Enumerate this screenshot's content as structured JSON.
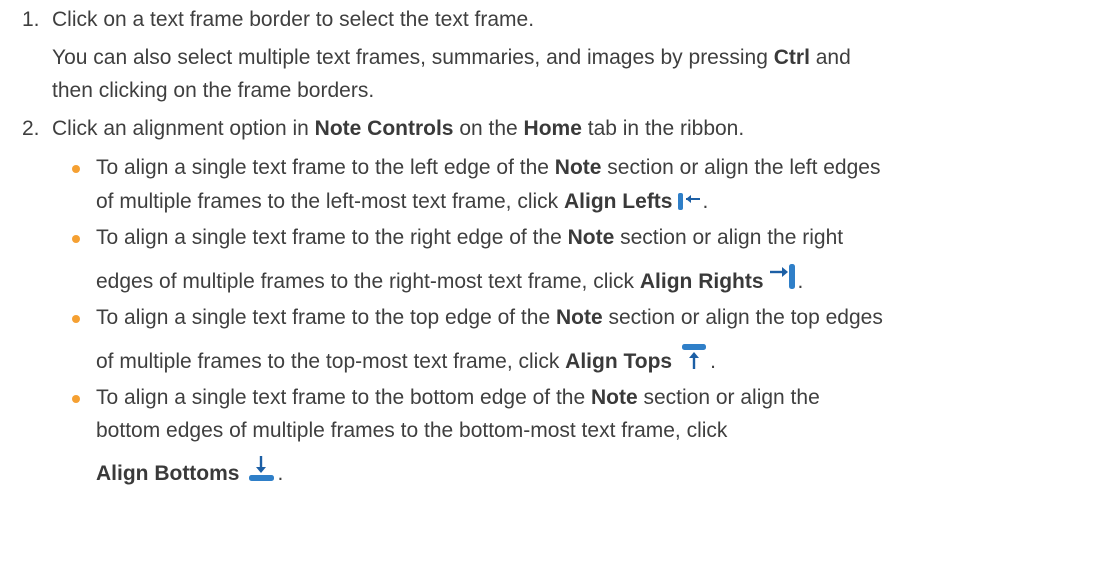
{
  "steps": [
    {
      "number": "1.",
      "line1": "Click on a text frame border to select the text frame.",
      "note_a": "You can also select multiple text frames, summaries, and images by pressing ",
      "note_key": "Ctrl",
      "note_b": " and",
      "note_c": "then clicking on the frame borders."
    },
    {
      "number": "2.",
      "t1": "Click an alignment option in ",
      "t2": "Note Controls",
      "t3": " on the ",
      "t4": "Home",
      "t5": " tab in the ribbon."
    }
  ],
  "bullets": [
    {
      "a": "To align a single text frame to the left edge of the ",
      "b": "Note",
      "c": " section or align the left edges",
      "d": "of multiple frames to the left-most text frame, click ",
      "e": "Align Lefts",
      "icon": "align-lefts-icon"
    },
    {
      "a": "To align a single text frame to the right edge of the ",
      "b": "Note",
      "c": " section or align the right",
      "d": "edges of multiple frames to the right-most text frame, click ",
      "e": "Align Rights",
      "icon": "align-rights-icon"
    },
    {
      "a": "To align a single text frame to the top edge of the ",
      "b": "Note",
      "c": " section or align the top edges",
      "d": "of multiple frames to the top-most text frame, click ",
      "e": "Align Tops",
      "icon": "align-tops-icon"
    },
    {
      "a": "To align a single text frame to the bottom edge of the ",
      "b": "Note",
      "c": " section or align the",
      "d": "bottom edges of multiple frames to the bottom-most text frame, click",
      "e": "Align Bottoms",
      "icon": "align-bottoms-icon"
    }
  ],
  "period": ".",
  "colors": {
    "text": "#3f3f3f",
    "bullet": "#f5a032",
    "icon": "#2f7fc8"
  }
}
